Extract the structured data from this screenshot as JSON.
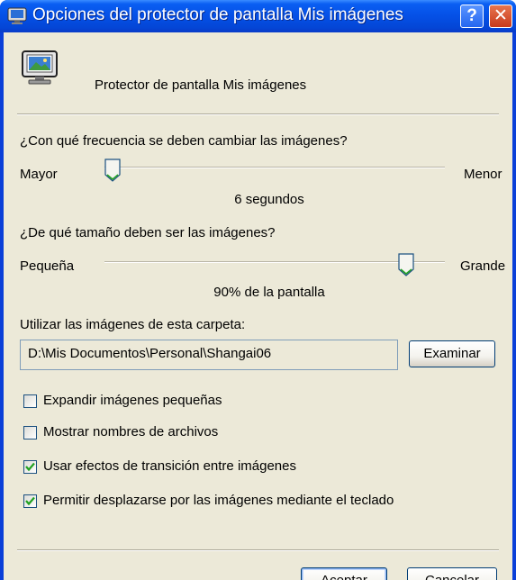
{
  "window": {
    "title": "Opciones del protector de pantalla Mis imágenes",
    "help_glyph": "?",
    "close_glyph": "✕"
  },
  "header": {
    "label": "Protector de pantalla Mis imágenes",
    "icon": "monitor-icon"
  },
  "frequency": {
    "question": "¿Con qué frecuencia se deben cambiar las imágenes?",
    "min_label": "Mayor",
    "max_label": "Menor",
    "value_label": "6 segundos",
    "level": 0.0
  },
  "size": {
    "question": "¿De qué tamaño deben ser las imágenes?",
    "min_label": "Pequeña",
    "max_label": "Grande",
    "value_label": "90% de la pantalla",
    "level": 0.9
  },
  "folder": {
    "label": "Utilizar las imágenes de esta carpeta:",
    "path": "D:\\Mis Documentos\\Personal\\Shangai06",
    "browse_label": "Examinar"
  },
  "options": [
    {
      "label": "Expandir imágenes pequeñas",
      "checked": false
    },
    {
      "label": "Mostrar nombres de archivos",
      "checked": false
    },
    {
      "label": "Usar efectos de transición entre imágenes",
      "checked": true
    },
    {
      "label": "Permitir desplazarse por las imágenes mediante el teclado",
      "checked": true
    }
  ],
  "footer": {
    "ok_label": "Aceptar",
    "cancel_label": "Cancelar"
  },
  "colors": {
    "title_bar": "#0550e6",
    "dialog_bg": "#ece9d8",
    "check_mark": "#21a121"
  }
}
